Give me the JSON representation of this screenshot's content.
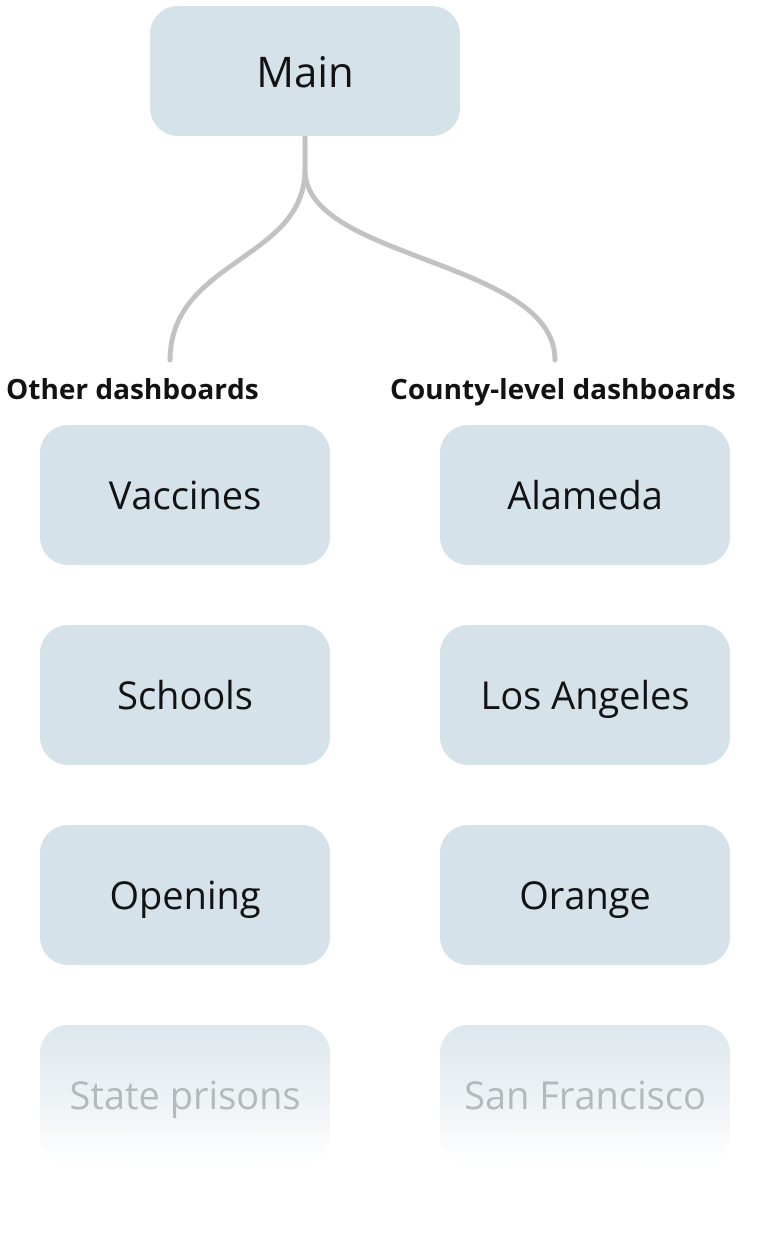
{
  "root": {
    "label": "Main"
  },
  "columns": {
    "left": {
      "header": "Other dashboards",
      "items": [
        {
          "label": "Vaccines"
        },
        {
          "label": "Schools"
        },
        {
          "label": "Opening"
        },
        {
          "label": "State prisons"
        }
      ]
    },
    "right": {
      "header": "County-level dashboards",
      "items": [
        {
          "label": "Alameda"
        },
        {
          "label": "Los Angeles"
        },
        {
          "label": "Orange"
        },
        {
          "label": "San Francisco"
        }
      ]
    }
  },
  "colors": {
    "node_bg": "#d5e2e9",
    "text": "#121212",
    "connector": "#c2c2c2",
    "faded_text": "#b4b9bc"
  }
}
